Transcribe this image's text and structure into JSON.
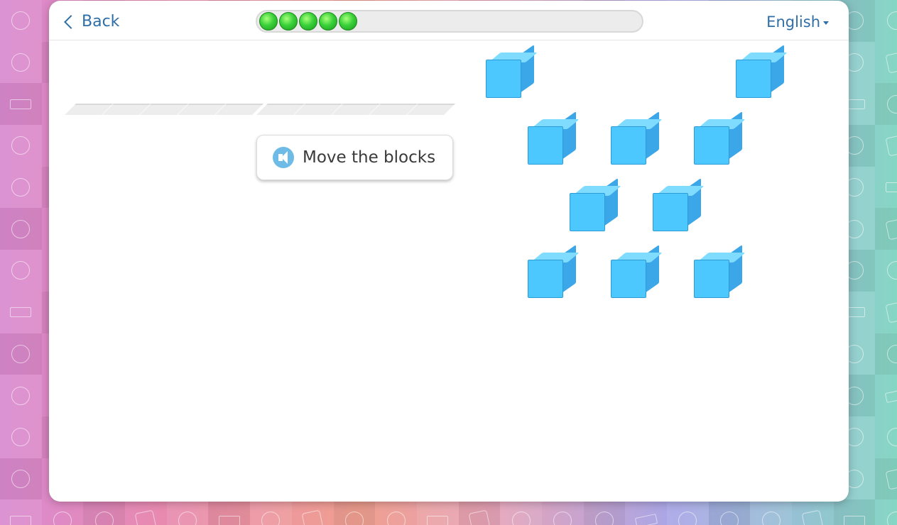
{
  "header": {
    "back_label": "Back",
    "language_label": "English",
    "progress": {
      "completed": 5
    }
  },
  "task": {
    "prompt": "Move the blocks"
  },
  "answer_area": {
    "slot_count": 10
  },
  "blocks": {
    "count": 10
  },
  "colors": {
    "accent": "#2f6fa7",
    "block": "#4dc8ff",
    "progress_dot": "#3ad13a"
  }
}
